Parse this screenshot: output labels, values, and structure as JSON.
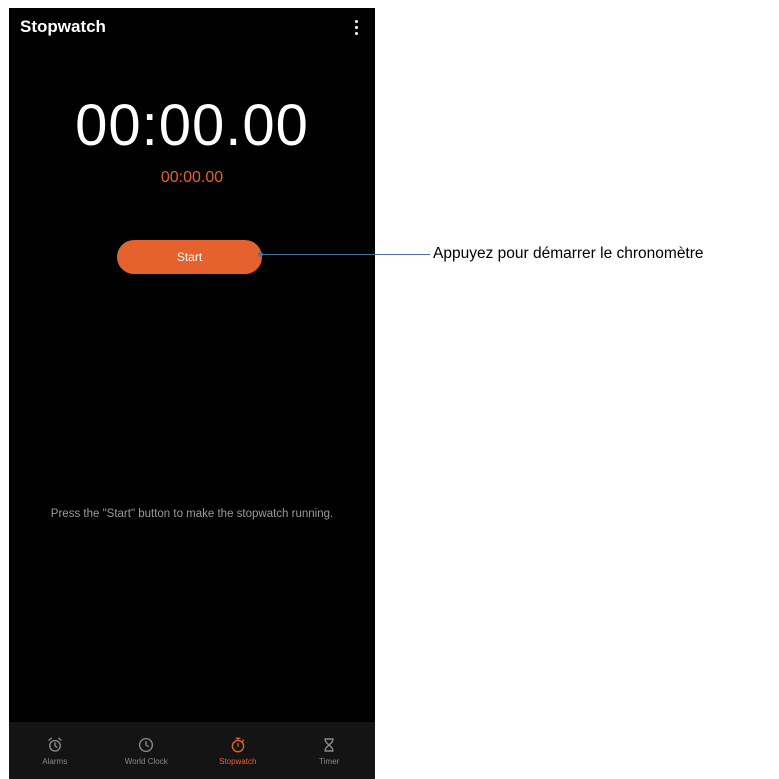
{
  "app": {
    "title": "Stopwatch",
    "menu_icon": "more-vert-icon"
  },
  "stopwatch": {
    "main_time": "00:00.00",
    "lap_time": "00:00.00",
    "start_label": "Start",
    "hint": "Press the \"Start\" button to make the stopwatch running."
  },
  "nav": {
    "items": [
      {
        "label": "Alarms",
        "icon": "alarm-clock-icon",
        "active": false
      },
      {
        "label": "World Clock",
        "icon": "clock-icon",
        "active": false
      },
      {
        "label": "Stopwatch",
        "icon": "stopwatch-icon",
        "active": true
      },
      {
        "label": "Timer",
        "icon": "hourglass-icon",
        "active": false
      }
    ]
  },
  "callout": {
    "text": "Appuyez pour démarrer le chronomètre"
  },
  "colors": {
    "accent": "#e5612d",
    "background": "#000000",
    "nav_background": "#141414",
    "inactive": "#8a8a8a",
    "callout_line": "#4a6fa5"
  }
}
